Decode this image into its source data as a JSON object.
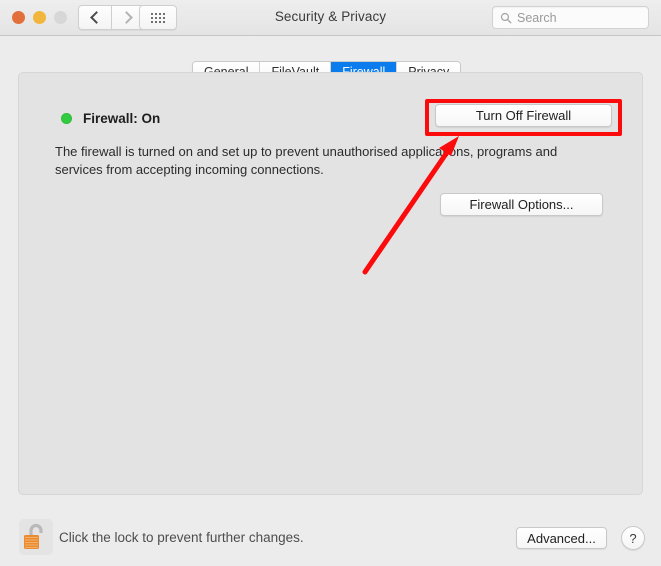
{
  "window": {
    "title": "Security & Privacy",
    "traffic_lights": [
      "close",
      "minimize",
      "zoom"
    ],
    "nav": {
      "back_icon": "chevron-left-icon",
      "forward_icon": "chevron-right-icon",
      "grid_icon": "show-all-grid-icon"
    },
    "search": {
      "placeholder": "Search",
      "icon": "search-icon",
      "value": ""
    }
  },
  "tabs": [
    {
      "label": "General",
      "active": false
    },
    {
      "label": "FileVault",
      "active": false
    },
    {
      "label": "Firewall",
      "active": true
    },
    {
      "label": "Privacy",
      "active": false
    }
  ],
  "main": {
    "status": {
      "label": "Firewall: On",
      "dot_color": "#33cc40"
    },
    "turn_off_button": "Turn Off Firewall",
    "description": "The firewall is turned on and set up to prevent unauthorised applications, programs and services from accepting incoming connections.",
    "firewall_options_button": "Firewall Options..."
  },
  "annotation": {
    "color": "#fb0b0b",
    "box_target": "Turn Off Firewall",
    "arrow": "points from lower-left to Turn Off Firewall button"
  },
  "footer": {
    "lock_icon": "unlocked-padlock-icon",
    "lock_text": "Click the lock to prevent further changes.",
    "advanced_button": "Advanced...",
    "help_button": "?"
  },
  "colors": {
    "accent": "#0b7cee",
    "window_bg": "#ececec",
    "panel_bg": "#e3e3e3",
    "annotation_red": "#fb0b0b",
    "status_green": "#33cc40"
  }
}
